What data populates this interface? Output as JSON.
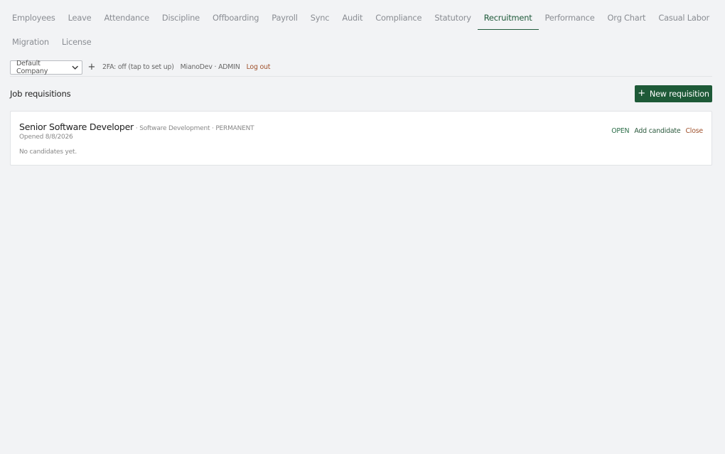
{
  "tabs": [
    {
      "label": "Employees",
      "active": false
    },
    {
      "label": "Leave",
      "active": false
    },
    {
      "label": "Attendance",
      "active": false
    },
    {
      "label": "Discipline",
      "active": false
    },
    {
      "label": "Offboarding",
      "active": false
    },
    {
      "label": "Payroll",
      "active": false
    },
    {
      "label": "Sync",
      "active": false
    },
    {
      "label": "Audit",
      "active": false
    },
    {
      "label": "Compliance",
      "active": false
    },
    {
      "label": "Statutory",
      "active": false
    },
    {
      "label": "Recruitment",
      "active": true
    },
    {
      "label": "Performance",
      "active": false
    },
    {
      "label": "Org Chart",
      "active": false
    },
    {
      "label": "Casual Labor",
      "active": false
    },
    {
      "label": "Migration",
      "active": false
    },
    {
      "label": "License",
      "active": false
    }
  ],
  "toolbar": {
    "company": "Default Company",
    "add_icon": "plus-icon",
    "twofa": "2FA: off (tap to set up)",
    "user": "MianoDev · ADMIN",
    "logout": "Log out"
  },
  "section": {
    "title": "Job requisitions",
    "new_button": "New requisition",
    "new_icon": "plus-icon"
  },
  "requisition": {
    "title": "Senior Software Developer",
    "subtitle": "· Software Development · PERMANENT",
    "opened": "Opened 8/8/2026",
    "candidates": "No candidates yet.",
    "status": "OPEN",
    "add_candidate": "Add candidate",
    "close": "Close"
  },
  "colors": {
    "accent": "#1e5a38",
    "danger_link": "#a0522d",
    "background": "#f2f3f5"
  }
}
